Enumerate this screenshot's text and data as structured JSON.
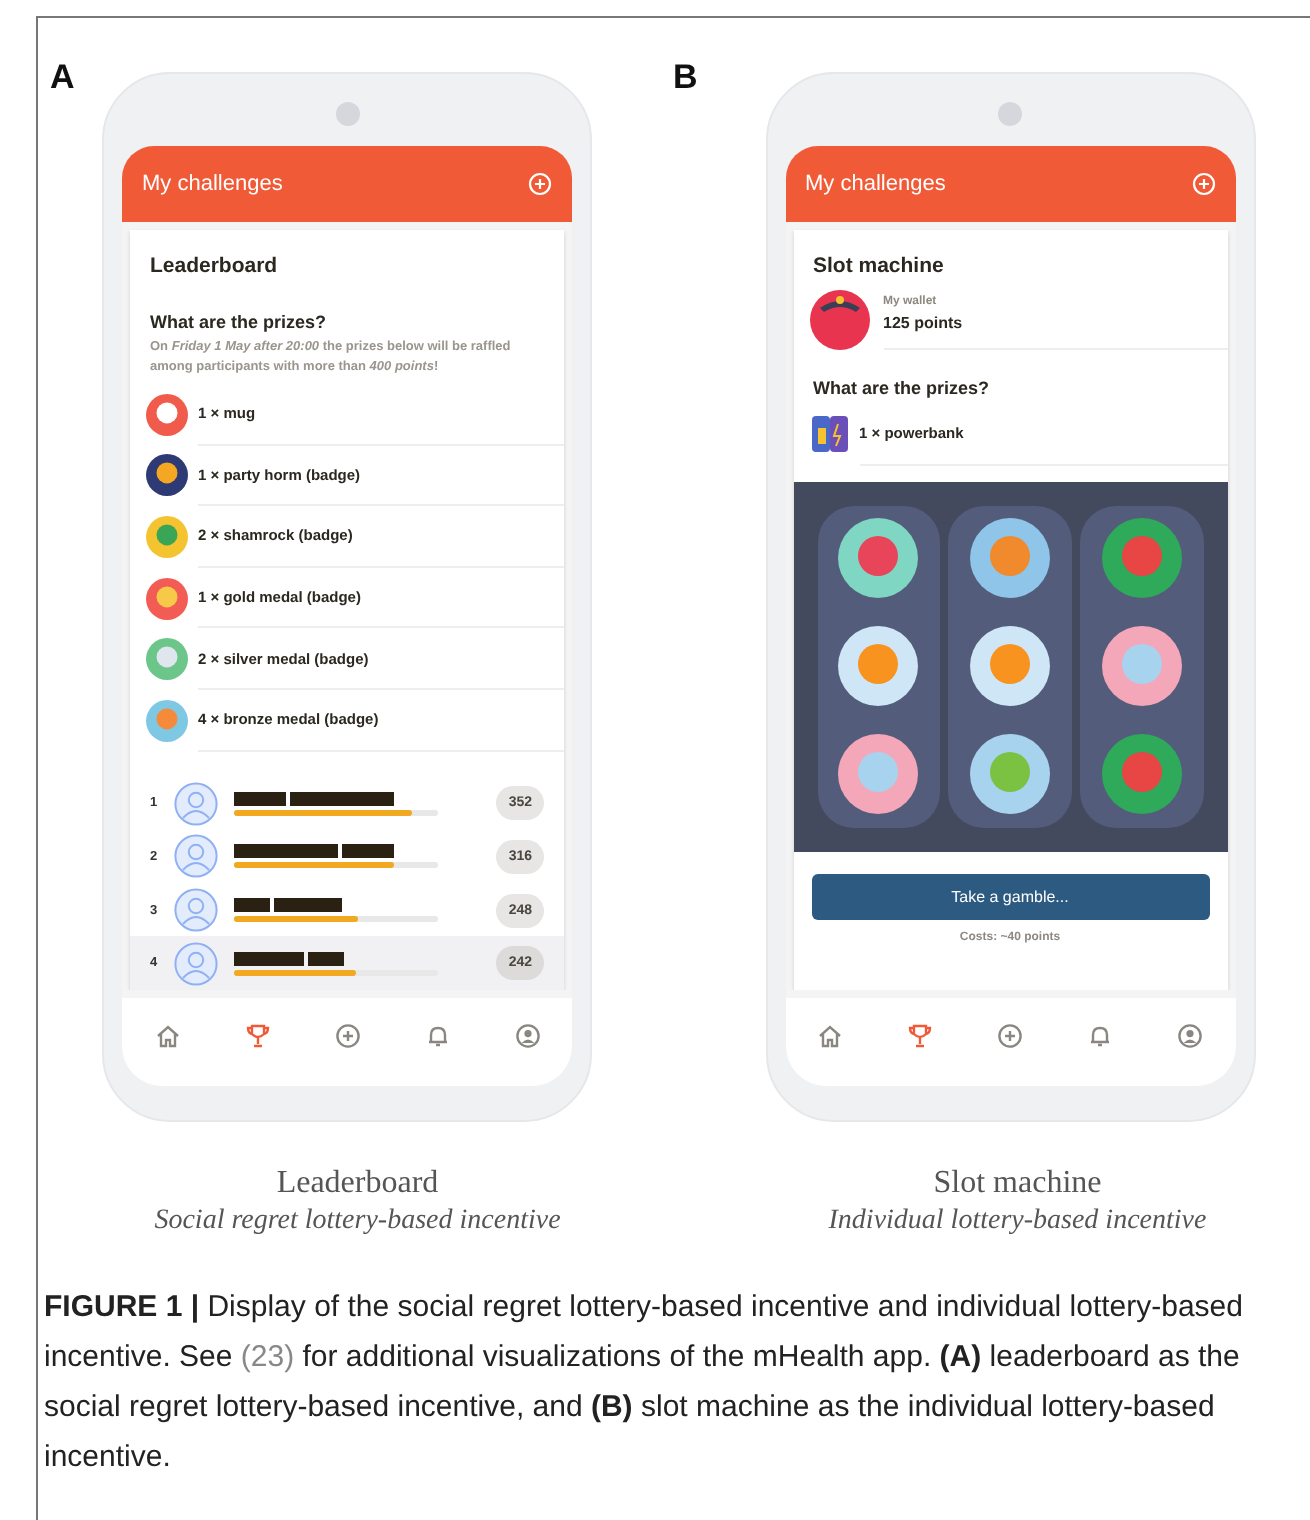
{
  "panels": [
    {
      "letter": "A",
      "header": {
        "title": "My challenges"
      },
      "screen": {
        "kind": "leaderboard",
        "title": "Leaderboard",
        "prizes_title": "What are the prizes?",
        "prizes_note": "On *Friday 1 May after 20:00* the prizes below will be raffled among participants with more than *400 points*!",
        "prizes": [
          {
            "label": "1 × mug"
          },
          {
            "label": "1 × party horm (badge)"
          },
          {
            "label": "2 × shamrock (badge)"
          },
          {
            "label": "1 × gold medal (badge)"
          },
          {
            "label": "2 × silver medal (badge)"
          },
          {
            "label": "4 × bronze medal (badge)"
          }
        ],
        "ranking": [
          {
            "rank": "1",
            "level": 0.87,
            "score": "352",
            "highlighted": false
          },
          {
            "rank": "2",
            "level": 0.78,
            "score": "316",
            "highlighted": false
          },
          {
            "rank": "3",
            "level": 0.61,
            "score": "248",
            "highlighted": false
          },
          {
            "rank": "4",
            "level": 0.6,
            "score": "242",
            "highlighted": true
          }
        ]
      },
      "nav": [
        {
          "kind": "home",
          "selected": false
        },
        {
          "kind": "trophy",
          "selected": true
        },
        {
          "kind": "add",
          "selected": false
        },
        {
          "kind": "bell",
          "selected": false
        },
        {
          "kind": "profile",
          "selected": false
        }
      ],
      "caption": {
        "title": "Leaderboard",
        "subtitle": "Social regret lottery-based incentive"
      }
    },
    {
      "letter": "B",
      "header": {
        "title": "My challenges"
      },
      "screen": {
        "kind": "slot",
        "title": "Slot machine",
        "wallet_label": "My wallet",
        "wallet_value": "125 points",
        "prizes_title": "What are the prizes?",
        "prizes": [
          {
            "label": "1 × powerbank"
          }
        ],
        "button": "Take a gamble...",
        "cost": "Costs: ~40 points"
      },
      "nav": [
        {
          "kind": "home",
          "selected": false
        },
        {
          "kind": "trophy",
          "selected": true
        },
        {
          "kind": "add",
          "selected": false
        },
        {
          "kind": "bell",
          "selected": false
        },
        {
          "kind": "profile",
          "selected": false
        }
      ],
      "caption": {
        "title": "Slot machine",
        "subtitle": "Individual lottery-based incentive"
      }
    }
  ],
  "figure_caption": {
    "before": "**FIGURE 1 |** Display of the social regret lottery-based incentive and individual lottery-based incentive. See",
    "link": "(23)",
    "after": "for additional visualizations of the mHealth app. **(A)** leaderboard as the social regret lottery-based incentive, and **(B)** slot machine as the individual lottery-based incentive."
  }
}
